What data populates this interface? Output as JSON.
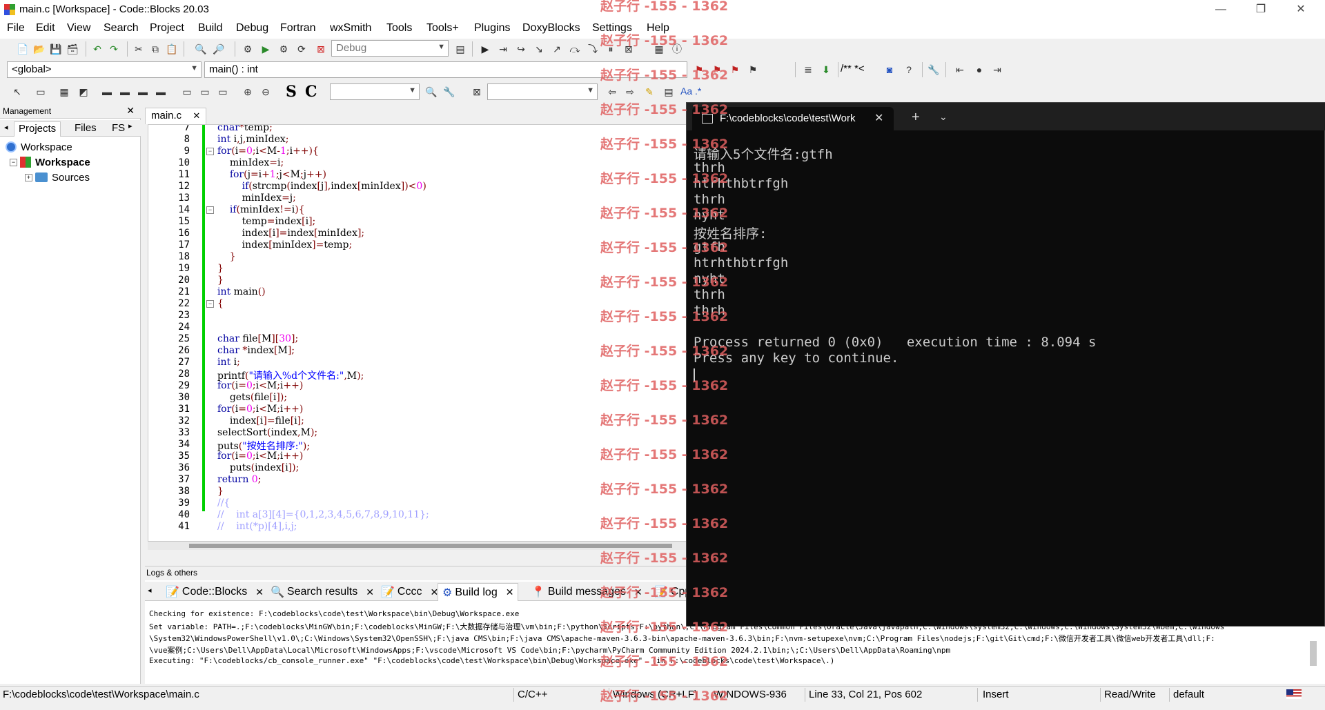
{
  "window": {
    "title": "main.c [Workspace] - Code::Blocks 20.03",
    "controls": [
      "—",
      "❐",
      "✕"
    ]
  },
  "menu": [
    "File",
    "Edit",
    "View",
    "Search",
    "Project",
    "Build",
    "Debug",
    "Fortran",
    "wxSmith",
    "Tools",
    "Tools+",
    "Plugins",
    "DoxyBlocks",
    "Settings",
    "Help"
  ],
  "toolbar": {
    "build_target": "Debug",
    "scope": "<global>",
    "function": "main() : int",
    "regex_label": "Aa .*",
    "comment_label": "/** *<",
    "s_label": "S",
    "c_label": "C"
  },
  "management": {
    "title": "Management",
    "tabs": [
      "Projects",
      "Files",
      "FS"
    ],
    "tree": [
      {
        "label": "Workspace",
        "bold": false
      },
      {
        "label": "Workspace",
        "bold": true
      },
      {
        "label": "Sources",
        "bold": false
      }
    ]
  },
  "editor": {
    "tab": "main.c",
    "lines": [
      {
        "n": "7",
        "t": "char*temp;"
      },
      {
        "n": "8",
        "t": "int i,j,minIdex;"
      },
      {
        "n": "9",
        "t": "for(i=0;i<M-1;i++){"
      },
      {
        "n": "10",
        "t": "    minIdex=i;"
      },
      {
        "n": "11",
        "t": "    for(j=i+1;j<M;j++)"
      },
      {
        "n": "12",
        "t": "        if(strcmp(index[j],index[minIdex])<0)"
      },
      {
        "n": "13",
        "t": "        minIdex=j;"
      },
      {
        "n": "14",
        "t": "    if(minIdex!=i){"
      },
      {
        "n": "15",
        "t": "        temp=index[i];"
      },
      {
        "n": "16",
        "t": "        index[i]=index[minIdex];"
      },
      {
        "n": "17",
        "t": "        index[minIdex]=temp;"
      },
      {
        "n": "18",
        "t": "    }"
      },
      {
        "n": "19",
        "t": "}"
      },
      {
        "n": "20",
        "t": "}"
      },
      {
        "n": "21",
        "t": "int main()"
      },
      {
        "n": "22",
        "t": "{"
      },
      {
        "n": "23",
        "t": ""
      },
      {
        "n": "24",
        "t": ""
      },
      {
        "n": "25",
        "t": "char file[M][30];"
      },
      {
        "n": "26",
        "t": "char *index[M];"
      },
      {
        "n": "27",
        "t": "int i;"
      },
      {
        "n": "28",
        "t": "printf(\"请输入%d个文件名:\",M);"
      },
      {
        "n": "29",
        "t": "for(i=0;i<M;i++)"
      },
      {
        "n": "30",
        "t": "    gets(file[i]);"
      },
      {
        "n": "31",
        "t": "for(i=0;i<M;i++)"
      },
      {
        "n": "32",
        "t": "    index[i]=file[i];"
      },
      {
        "n": "33",
        "t": "selectSort(index,M);"
      },
      {
        "n": "34",
        "t": "puts(\"按姓名排序:\");"
      },
      {
        "n": "35",
        "t": "for(i=0;i<M;i++)"
      },
      {
        "n": "36",
        "t": "    puts(index[i]);"
      },
      {
        "n": "37",
        "t": "return 0;"
      },
      {
        "n": "38",
        "t": "}"
      },
      {
        "n": "39",
        "t": "//{"
      },
      {
        "n": "40",
        "t": "//    int a[3][4]={0,1,2,3,4,5,6,7,8,9,10,11};"
      },
      {
        "n": "41",
        "t": "//    int(*p)[4],i,j;"
      }
    ]
  },
  "logs": {
    "title": "Logs & others",
    "tabs": [
      "Code::Blocks",
      "Search results",
      "Cccc",
      "Build log",
      "Build messages",
      "Cppc"
    ],
    "lines": [
      "Checking for existence: F:\\codeblocks\\code\\test\\Workspace\\bin\\Debug\\Workspace.exe",
      "Set variable: PATH=.;F:\\codeblocks\\MinGW\\bin;F:\\codeblocks\\MinGW;F:\\大数据存储与治理\\vm\\bin;F:\\python\\Scripts;F:\\python\\;C:\\Program Files\\Common Files\\Oracle\\Java\\javapath;C:\\Windows\\system32;C:\\Windows;C:\\Windows\\System32\\Wbem;C:\\Windows",
      "\\System32\\WindowsPowerShell\\v1.0\\;C:\\Windows\\System32\\OpenSSH\\;F:\\java CMS\\bin;F:\\java CMS\\apache-maven-3.6.3-bin\\apache-maven-3.6.3\\bin;F:\\nvm-setupexe\\nvm;C:\\Program Files\\nodejs;F:\\git\\Git\\cmd;F:\\微信开发者工具\\微信web开发者工具\\dll;F:",
      "\\vue案例;C:\\Users\\Dell\\AppData\\Local\\Microsoft\\WindowsApps;F:\\vscode\\Microsoft VS Code\\bin;F:\\pycharm\\PyCharm Community Edition 2024.2.1\\bin;\\;C:\\Users\\Dell\\AppData\\Roaming\\npm",
      "Executing: \"F:\\codeblocks/cb_console_runner.exe\" \"F:\\codeblocks\\code\\test\\Workspace\\bin\\Debug\\Workspace.exe\"  (in F:\\codeblocks\\code\\test\\Workspace\\.)"
    ]
  },
  "status": {
    "path": "F:\\codeblocks\\code\\test\\Workspace\\main.c",
    "lang": "C/C++",
    "eol": "Windows (CR+LF)",
    "encoding": "WINDOWS-936",
    "position": "Line 33, Col 21, Pos 602",
    "mode": "Insert",
    "access": "Read/Write",
    "profile": "default"
  },
  "terminal": {
    "tab_title": "F:\\codeblocks\\code\\test\\Work",
    "lines": [
      "请输入5个文件名:gtfh",
      "thrh",
      "htrhthbtrfgh",
      "thrh",
      "nyht",
      "按姓名排序:",
      "gtfh",
      "htrhthbtrfgh",
      "nyht",
      "thrh",
      "thrh",
      "",
      "Process returned 0 (0x0)   execution time : 8.094 s",
      "Press any key to continue."
    ]
  },
  "watermark": "赵子行 -155 - 1362",
  "colors": {
    "terminal_bg": "#0c0c0c",
    "change_bar": "#00d000",
    "keyword": "#0000a0",
    "string": "#0000ff",
    "number": "#f000f0"
  }
}
